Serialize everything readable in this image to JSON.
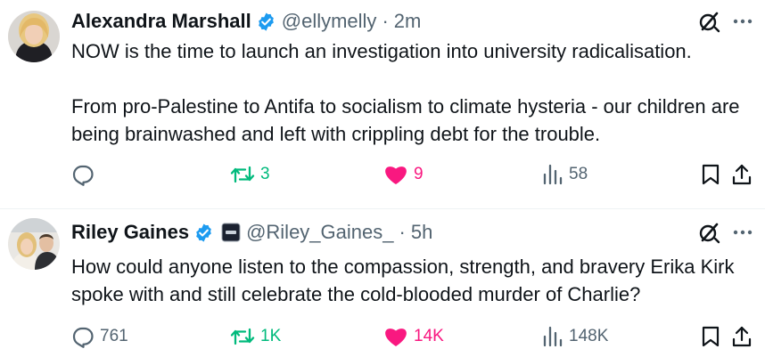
{
  "tweets": [
    {
      "author": {
        "name": "Alexandra Marshall",
        "handle": "@ellymelly",
        "time": "2m"
      },
      "text": [
        "NOW is the time to launch an investigation into university radicalisation.",
        "From pro-Palestine to Antifa to socialism to climate hysteria - our children are being brainwashed and left with crippling debt for the trouble."
      ],
      "stats": {
        "replies": "",
        "reposts": "3",
        "likes": "9",
        "views": "58"
      },
      "liked": true
    },
    {
      "author": {
        "name": "Riley Gaines",
        "handle": "@Riley_Gaines_",
        "time": "5h"
      },
      "text": [
        "How could anyone listen to the compassion, strength, and bravery Erika Kirk spoke with and still celebrate the cold-blooded murder of Charlie?"
      ],
      "stats": {
        "replies": "761",
        "reposts": "1K",
        "likes": "14K",
        "views": "148K"
      },
      "liked": true
    }
  ],
  "colors": {
    "text": "#0f1419",
    "secondary": "#536471",
    "retweet": "#00ba7c",
    "like": "#f91880",
    "verified": "#1d9bf0"
  },
  "icons": [
    "reply-icon",
    "retweet-icon",
    "heart-icon",
    "views-icon",
    "bookmark-icon",
    "share-icon",
    "grok-icon",
    "more-icon",
    "verified-badge-icon"
  ]
}
